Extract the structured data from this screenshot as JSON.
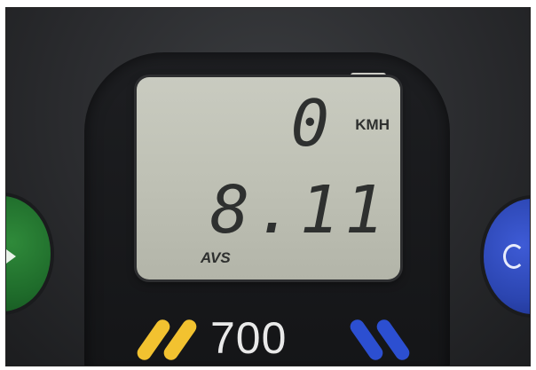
{
  "display": {
    "speed_value": "0",
    "speed_unit": "KMH",
    "average_value": "8.11",
    "average_label": "AVS"
  },
  "device": {
    "model_number": "700"
  },
  "colors": {
    "lcd_background": "#c4c6bb",
    "lcd_digits": "#2e302f",
    "left_button": "#1e6a2a",
    "right_button": "#2b45b0",
    "accent_yellow": "#f2c230",
    "accent_blue": "#2c4fd1"
  },
  "icons": {
    "left_button_icon": "play-arrow-icon",
    "right_button_icon": "circle-arrow-icon"
  }
}
